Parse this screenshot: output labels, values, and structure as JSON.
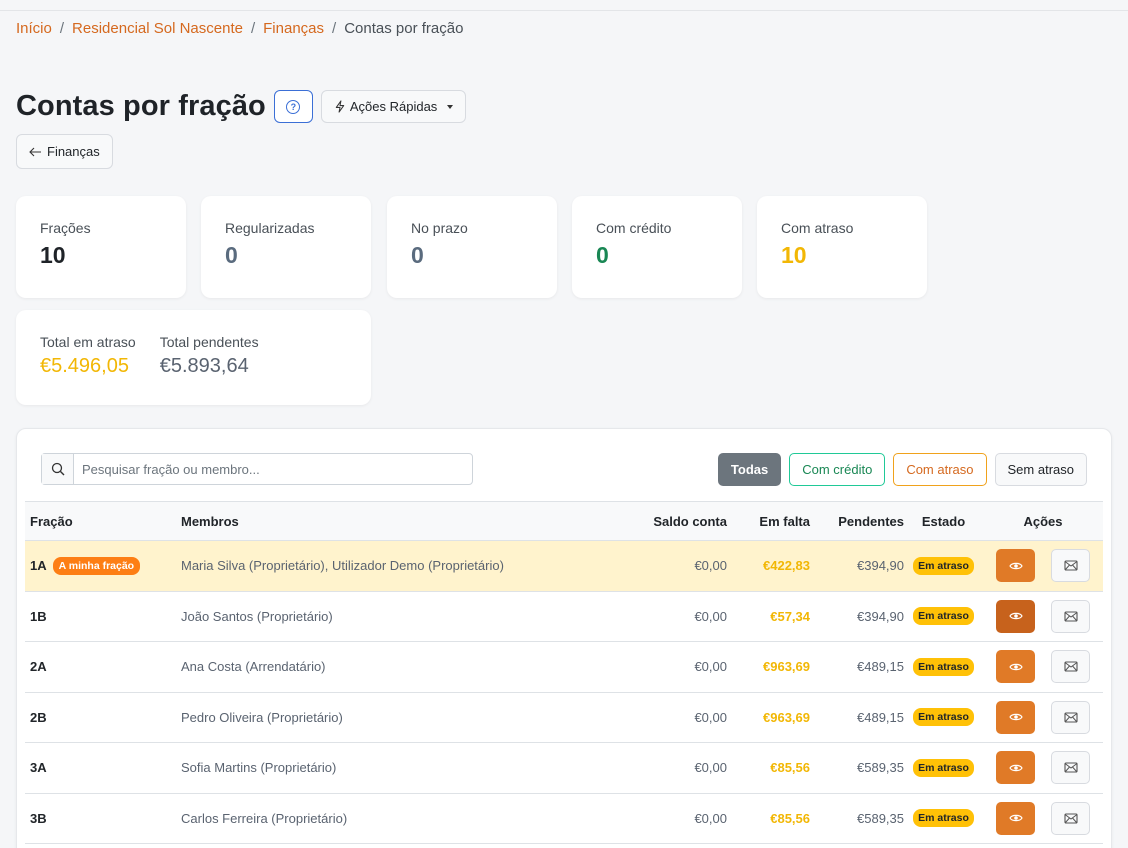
{
  "breadcrumb": {
    "items": [
      "Início",
      "Residencial Sol Nascente",
      "Finanças"
    ],
    "current": "Contas por fração",
    "separator": "/"
  },
  "header": {
    "title": "Contas por fração",
    "help_icon": "?",
    "quick_actions_label": "Ações Rápidas",
    "back_label": "Finanças"
  },
  "stats": [
    {
      "label": "Frações",
      "value": "10",
      "color": "#1f2328"
    },
    {
      "label": "Regularizadas",
      "value": "0",
      "color": "#5a6b7e"
    },
    {
      "label": "No prazo",
      "value": "0",
      "color": "#5a6b7e"
    },
    {
      "label": "Com crédito",
      "value": "0",
      "color": "#198754"
    },
    {
      "label": "Com atraso",
      "value": "10",
      "color": "#f2b705"
    }
  ],
  "totals": {
    "overdue_label": "Total em atraso",
    "overdue_value": "€5.496,05",
    "pending_label": "Total pendentes",
    "pending_value": "€5.893,64"
  },
  "search": {
    "placeholder": "Pesquisar fração ou membro..."
  },
  "filters": {
    "all": "Todas",
    "credit": "Com crédito",
    "late": "Com atraso",
    "none": "Sem atraso"
  },
  "table": {
    "columns": {
      "fracao": "Fração",
      "membros": "Membros",
      "saldo": "Saldo conta",
      "falta": "Em falta",
      "pendentes": "Pendentes",
      "estado": "Estado",
      "acoes": "Ações"
    },
    "mine_badge": "A minha fração",
    "rows": [
      {
        "fracao": "1A",
        "mine": true,
        "membros": "Maria Silva (Proprietário), Utilizador Demo (Proprietário)",
        "saldo": "€0,00",
        "falta": "€422,83",
        "pendentes": "€394,90",
        "estado": "Em atraso"
      },
      {
        "fracao": "1B",
        "mine": false,
        "membros": "João Santos (Proprietário)",
        "saldo": "€0,00",
        "falta": "€57,34",
        "pendentes": "€394,90",
        "estado": "Em atraso"
      },
      {
        "fracao": "2A",
        "mine": false,
        "membros": "Ana Costa (Arrendatário)",
        "saldo": "€0,00",
        "falta": "€963,69",
        "pendentes": "€489,15",
        "estado": "Em atraso"
      },
      {
        "fracao": "2B",
        "mine": false,
        "membros": "Pedro Oliveira (Proprietário)",
        "saldo": "€0,00",
        "falta": "€963,69",
        "pendentes": "€489,15",
        "estado": "Em atraso"
      },
      {
        "fracao": "3A",
        "mine": false,
        "membros": "Sofia Martins (Proprietário)",
        "saldo": "€0,00",
        "falta": "€85,56",
        "pendentes": "€589,35",
        "estado": "Em atraso"
      },
      {
        "fracao": "3B",
        "mine": false,
        "membros": "Carlos Ferreira (Proprietário)",
        "saldo": "€0,00",
        "falta": "€85,56",
        "pendentes": "€589,35",
        "estado": "Em atraso"
      }
    ]
  }
}
